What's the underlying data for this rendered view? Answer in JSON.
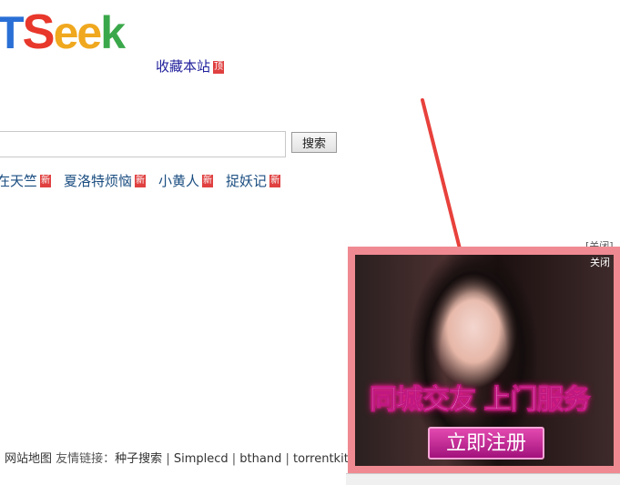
{
  "logo": {
    "letters": [
      "T",
      "S",
      "e",
      "e",
      "k"
    ],
    "colors": [
      "#2a6fd6",
      "#e8372b",
      "#f0a81f",
      "#f0a81f",
      "#3aa84a"
    ]
  },
  "bookmark": {
    "label": "收藏本站",
    "badge": "顶"
  },
  "search": {
    "value": "",
    "placeholder": "",
    "button_label": "搜索"
  },
  "hot_links": [
    {
      "label": "在天竺",
      "badge": "新"
    },
    {
      "label": "夏洛特烦恼",
      "badge": "新"
    },
    {
      "label": "小黄人",
      "badge": "新"
    },
    {
      "label": "捉妖记",
      "badge": "新"
    }
  ],
  "footer": {
    "sitemap": "网站地图",
    "friends_label": "友情链接：",
    "links": [
      "种子搜索",
      "Simplecd",
      "bthand",
      "torrentkit"
    ],
    "separator": " | "
  },
  "ad": {
    "close_outer": "[关闭]",
    "close_inner": "关闭",
    "tagline": "同城交友  上门服务",
    "cta": "立即注册",
    "border_color": "#f08a92"
  },
  "annotation": {
    "color": "#e8413c"
  }
}
